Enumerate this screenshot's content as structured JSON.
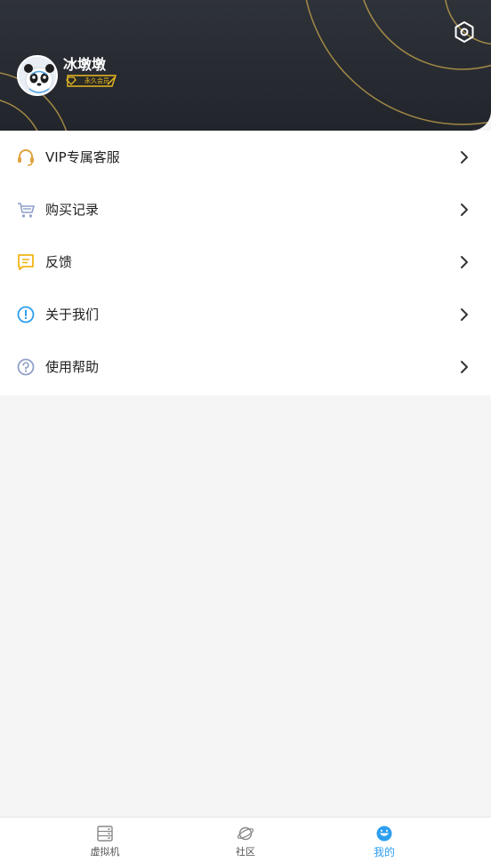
{
  "header": {
    "username": "冰墩墩",
    "vip_badge_text": "永久会员",
    "settings_icon": "hexagon-gear-icon",
    "ring_color": "#c9a64c"
  },
  "menu": {
    "items": [
      {
        "label": "VIP专属客服",
        "icon": "headset-icon",
        "icon_color": "#e0a340"
      },
      {
        "label": "购买记录",
        "icon": "cart-icon",
        "icon_color": "#8fa0c8"
      },
      {
        "label": "反馈",
        "icon": "message-square-icon",
        "icon_color": "#f2b416"
      },
      {
        "label": "关于我们",
        "icon": "info-circle-icon",
        "icon_color": "#2c9ef0"
      },
      {
        "label": "使用帮助",
        "icon": "help-circle-icon",
        "icon_color": "#8fa0c8"
      }
    ]
  },
  "tabbar": {
    "tabs": [
      {
        "label": "虚拟机",
        "icon": "server-stack-icon",
        "active": false
      },
      {
        "label": "社区",
        "icon": "planet-icon",
        "active": false
      },
      {
        "label": "我的",
        "icon": "smile-face-icon",
        "active": true
      }
    ],
    "active_color": "#2c9ef0"
  }
}
